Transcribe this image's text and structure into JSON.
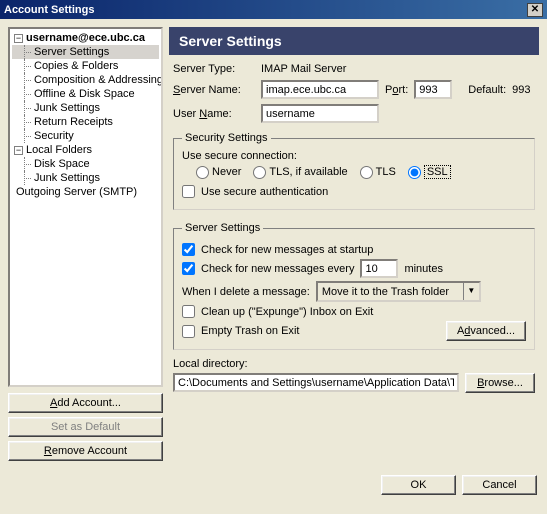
{
  "window": {
    "title": "Account Settings"
  },
  "tree": {
    "account": "username@ece.ubc.ca",
    "items": [
      "Server Settings",
      "Copies & Folders",
      "Composition & Addressing",
      "Offline & Disk Space",
      "Junk Settings",
      "Return Receipts",
      "Security"
    ],
    "local": "Local Folders",
    "localItems": [
      "Disk Space",
      "Junk Settings"
    ],
    "outgoing": "Outgoing Server (SMTP)"
  },
  "sidebarBtns": {
    "add": "Add Account...",
    "setDefault": "Set as Default",
    "remove": "Remove Account"
  },
  "main": {
    "title": "Server Settings",
    "serverTypeLabel": "Server Type:",
    "serverType": "IMAP Mail Server",
    "serverNameLabel": "Server Name:",
    "serverName": "imap.ece.ubc.ca",
    "portLabel": "Port:",
    "port": "993",
    "defaultLabel": "Default:",
    "defaultPort": "993",
    "userNameLabel": "User Name:",
    "userName": "username"
  },
  "security": {
    "legend": "Security Settings",
    "useSecure": "Use secure connection:",
    "opts": {
      "never": "Never",
      "tlsIf": "TLS, if available",
      "tls": "TLS",
      "ssl": "SSL"
    },
    "useAuth": "Use secure authentication"
  },
  "server": {
    "legend": "Server Settings",
    "checkStartup": "Check for new messages at startup",
    "checkEveryPre": "Check for new messages every",
    "checkEveryVal": "10",
    "checkEveryPost": "minutes",
    "whenDelete": "When I delete a message:",
    "deleteOpt": "Move it to the Trash folder",
    "cleanUp": "Clean up (\"Expunge\") Inbox on Exit",
    "emptyTrash": "Empty Trash on Exit",
    "advanced": "Advanced..."
  },
  "local": {
    "label": "Local directory:",
    "path": "C:\\Documents and Settings\\username\\Application Data\\Thu",
    "browse": "Browse..."
  },
  "footer": {
    "ok": "OK",
    "cancel": "Cancel"
  }
}
